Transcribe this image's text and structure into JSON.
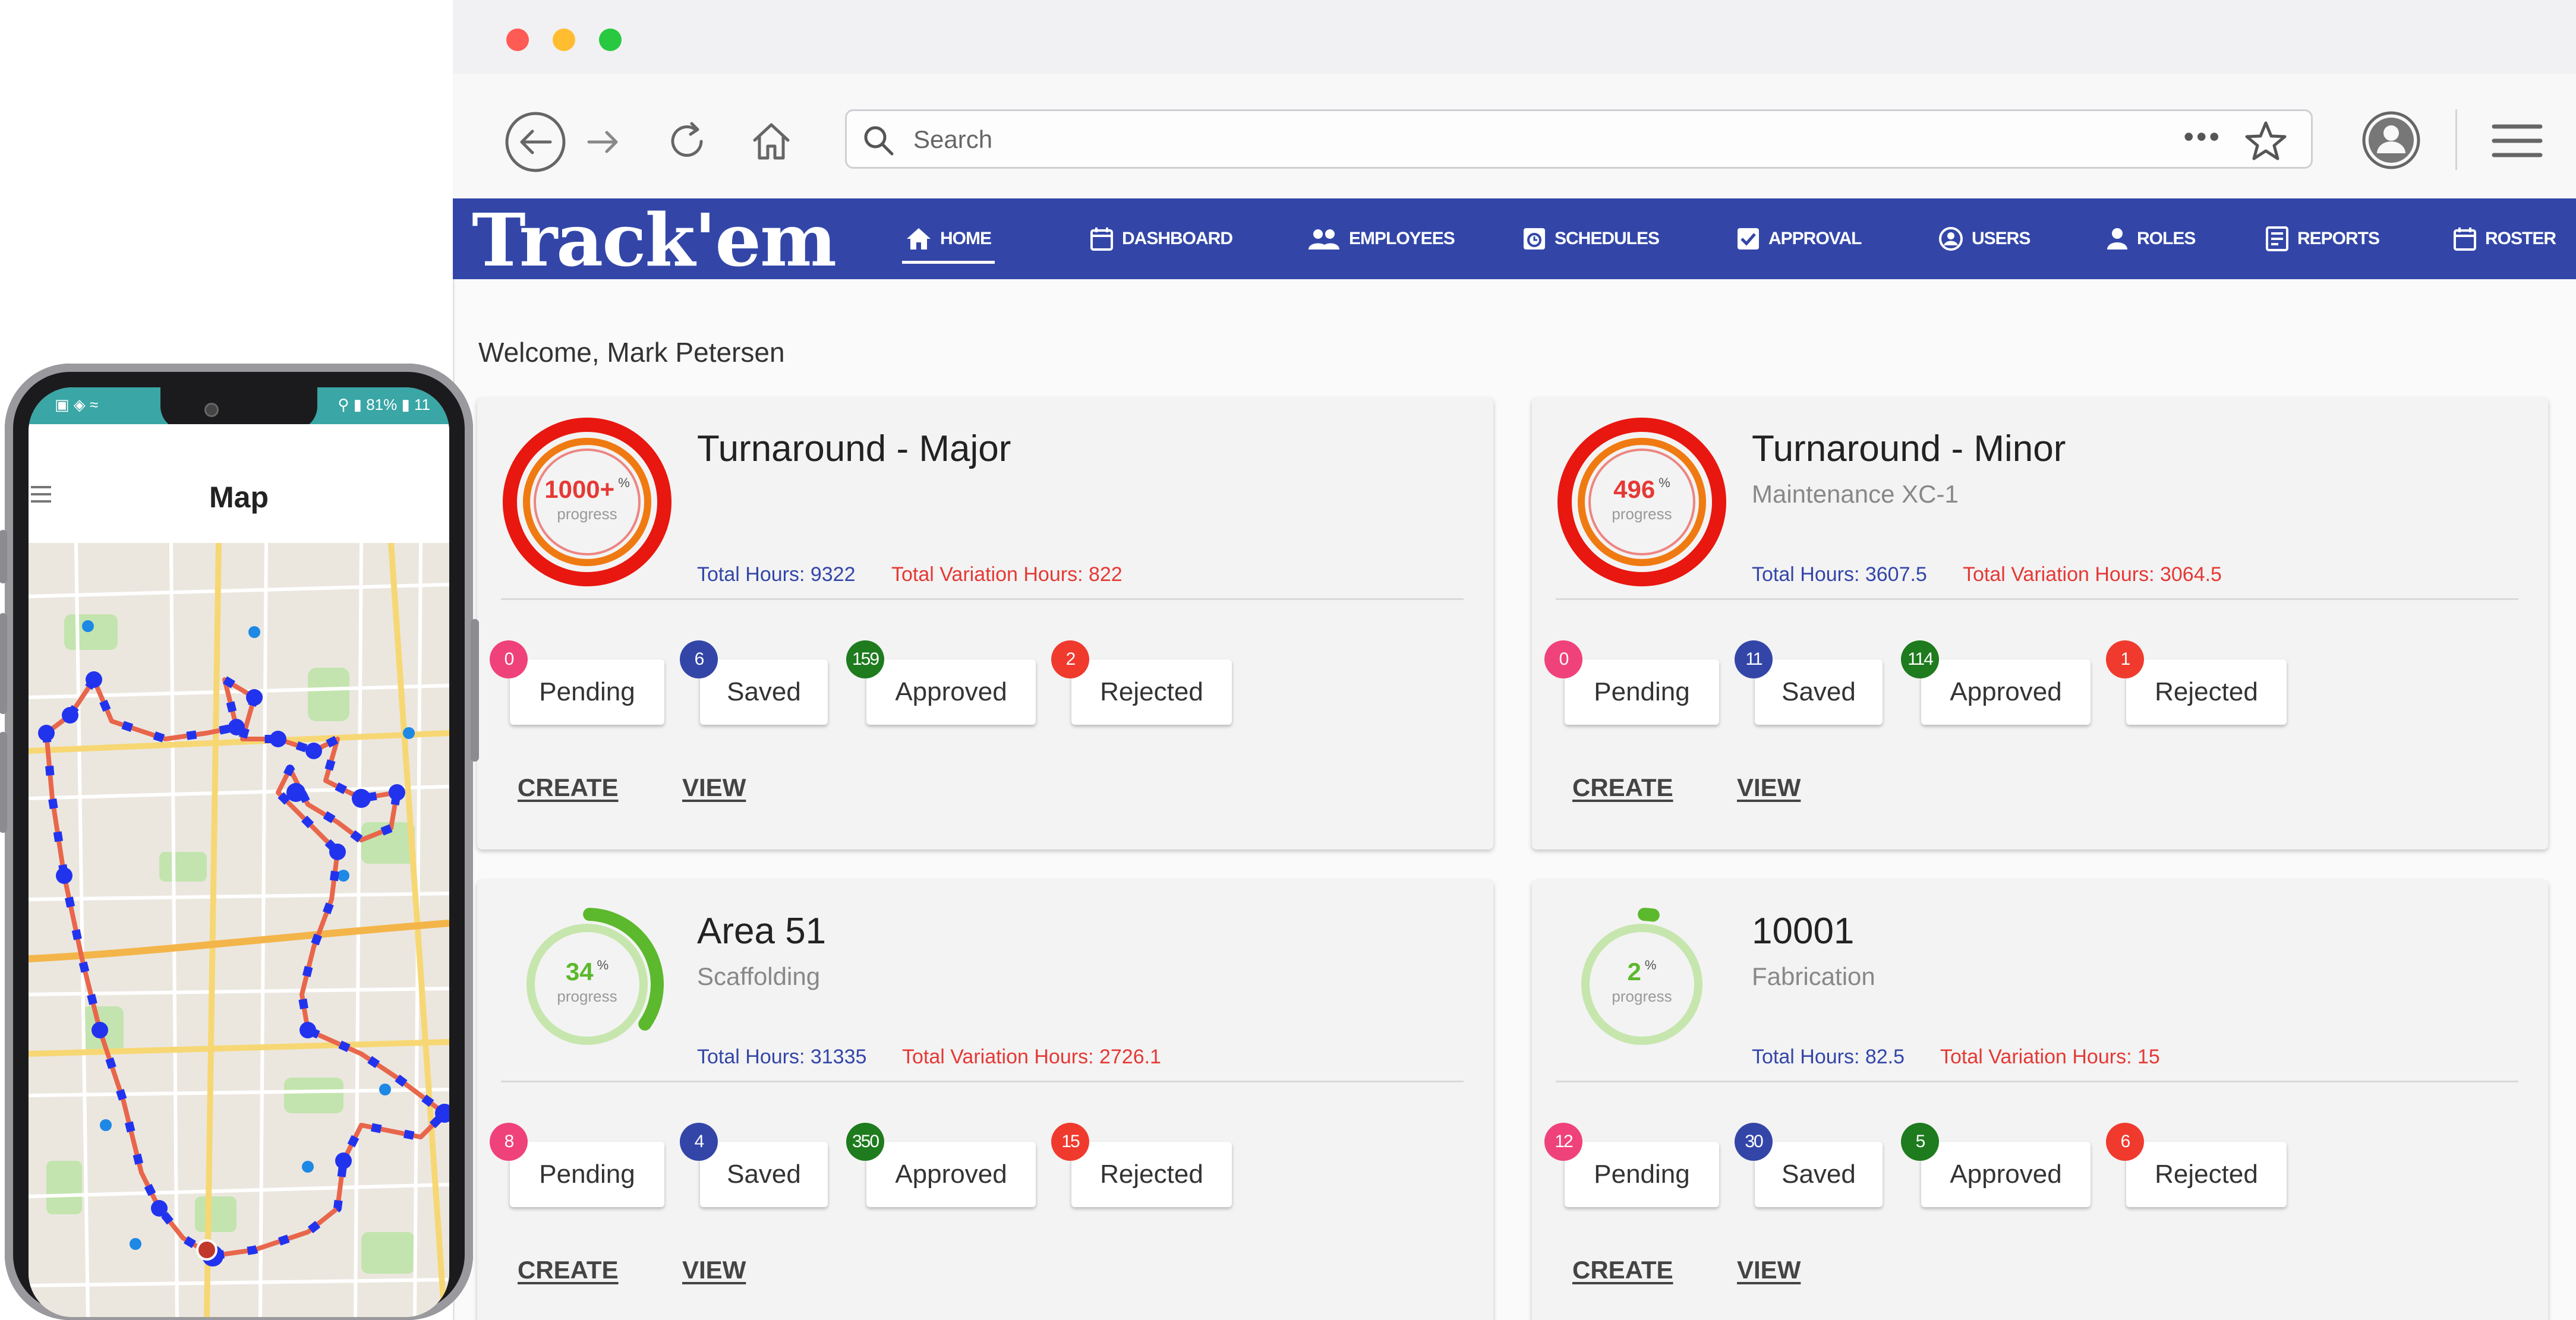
{
  "browser": {
    "search_placeholder": "Search",
    "more_label": "•••"
  },
  "app": {
    "logo": "Track'em",
    "nav": [
      {
        "label": "HOME",
        "icon": "home-icon"
      },
      {
        "label": "DASHBOARD",
        "icon": "calendar-icon"
      },
      {
        "label": "EMPLOYEES",
        "icon": "people-icon"
      },
      {
        "label": "SCHEDULES",
        "icon": "schedule-icon"
      },
      {
        "label": "APPROVAL",
        "icon": "check-box-icon"
      },
      {
        "label": "USERS",
        "icon": "users-icon"
      },
      {
        "label": "ROLES",
        "icon": "person-icon"
      },
      {
        "label": "REPORTS",
        "icon": "report-icon"
      },
      {
        "label": "ROSTER",
        "icon": "calendar-icon"
      }
    ],
    "welcome": "Welcome, Mark Petersen",
    "status_labels": {
      "pending": "Pending",
      "saved": "Saved",
      "approved": "Approved",
      "rejected": "Rejected"
    },
    "actions": {
      "create": "CREATE",
      "view": "VIEW"
    },
    "progress_word": "progress",
    "percent_sign": "%",
    "colors": {
      "nav": "#3346a8",
      "pending": "#f0427a",
      "saved": "#3346a8",
      "approved": "#1e7b1e",
      "rejected": "#f03a2e",
      "variation_text": "#e53935",
      "over_ring": "#e8170f",
      "over_ring_inner": "#f07a12",
      "normal_ring": "#5cb82c",
      "normal_ring_track": "#c6e6ad"
    },
    "projects": [
      {
        "title": "Turnaround - Major",
        "subtitle": "",
        "progress_label": "1000+",
        "progress": 1.0,
        "over": true,
        "total_hours": "Total Hours: 9322",
        "variation_hours": "Total Variation Hours: 822",
        "counts": {
          "pending": "0",
          "saved": "6",
          "approved": "159",
          "rejected": "2"
        }
      },
      {
        "title": "Turnaround - Minor",
        "subtitle": "Maintenance XC-1",
        "progress_label": "496",
        "progress": 1.0,
        "over": true,
        "total_hours": "Total Hours: 3607.5",
        "variation_hours": "Total Variation Hours: 3064.5",
        "counts": {
          "pending": "0",
          "saved": "11",
          "approved": "114",
          "rejected": "1"
        }
      },
      {
        "title": "Area 51",
        "subtitle": "Scaffolding",
        "progress_label": "34",
        "progress": 0.34,
        "over": false,
        "total_hours": "Total Hours: 31335",
        "variation_hours": "Total Variation Hours: 2726.1",
        "counts": {
          "pending": "8",
          "saved": "4",
          "approved": "350",
          "rejected": "15"
        }
      },
      {
        "title": "10001",
        "subtitle": "Fabrication",
        "progress_label": "2",
        "progress": 0.02,
        "over": false,
        "total_hours": "Total Hours: 82.5",
        "variation_hours": "Total Variation Hours: 15",
        "counts": {
          "pending": "12",
          "saved": "30",
          "approved": "5",
          "rejected": "6"
        }
      }
    ]
  },
  "phone": {
    "title": "Map",
    "status_left": "▣ ◈ ≈",
    "status_right": "⚲ ▮ 81% ▮ 11"
  }
}
